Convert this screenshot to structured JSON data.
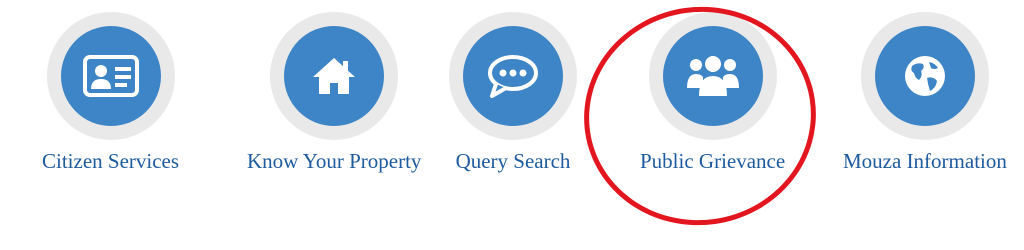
{
  "menu": {
    "items": [
      {
        "label": "Citizen Services",
        "icon": "id-card-icon"
      },
      {
        "label": "Know Your Property",
        "icon": "home-icon"
      },
      {
        "label": "Query Search",
        "icon": "chat-bubble-icon"
      },
      {
        "label": "Public Grievance",
        "icon": "users-group-icon"
      },
      {
        "label": "Mouza Information",
        "icon": "globe-icon"
      }
    ]
  },
  "colors": {
    "circle": "#3d85c6",
    "ring": "#e9e9e9",
    "label": "#1d5a9e",
    "highlight": "#e3161f"
  }
}
